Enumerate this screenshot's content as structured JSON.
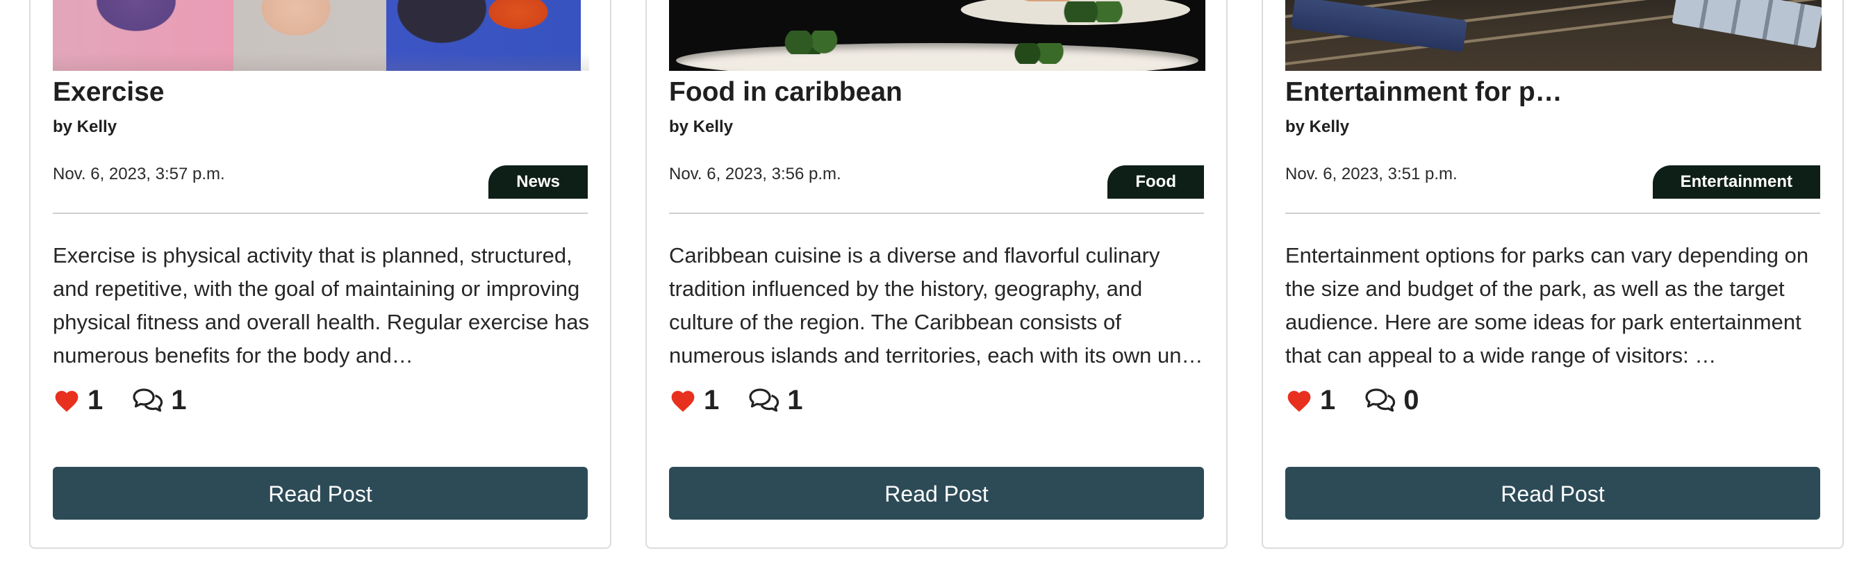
{
  "posts": [
    {
      "title": "Exercise",
      "author": "by Kelly",
      "date": "Nov. 6, 2023, 3:57 p.m.",
      "category": "News",
      "excerpt": "Exercise is physical activity that is planned, structured, and repetitive, with the goal of maintaining or improving physical fitness and overall health. Regular exercise has numerous benefits for the body and…",
      "likes": "1",
      "comments": "1",
      "button_label": "Read Post",
      "image": "exercise-yoga-photo"
    },
    {
      "title": "Food in caribbean",
      "author": "by Kelly",
      "date": "Nov. 6, 2023, 3:56 p.m.",
      "category": "Food",
      "excerpt": "Caribbean cuisine is a diverse and flavorful culinary tradition influenced by the history, geography, and culture of the region. The Caribbean consists of numerous islands and territories, each with its own un…",
      "likes": "1",
      "comments": "1",
      "button_label": "Read Post",
      "image": "food-plates-photo"
    },
    {
      "title": "Entertainment for p…",
      "author": "by Kelly",
      "date": "Nov. 6, 2023, 3:51 p.m.",
      "category": "Entertainment",
      "excerpt": "Entertainment options for parks can vary depending on the size and budget of the park, as well as the target audience. Here are some ideas for park entertainment that can appeal to a wide range of visitors: …",
      "likes": "1",
      "comments": "0",
      "button_label": "Read Post",
      "image": "train-yard-photo"
    }
  ],
  "colors": {
    "badge_bg": "#0e1f17",
    "button_bg": "#2d4b57",
    "like_heart": "#e8301f",
    "card_border": "#dcdcdc"
  },
  "icons": {
    "like": "heart-icon",
    "comment": "comments-icon"
  }
}
